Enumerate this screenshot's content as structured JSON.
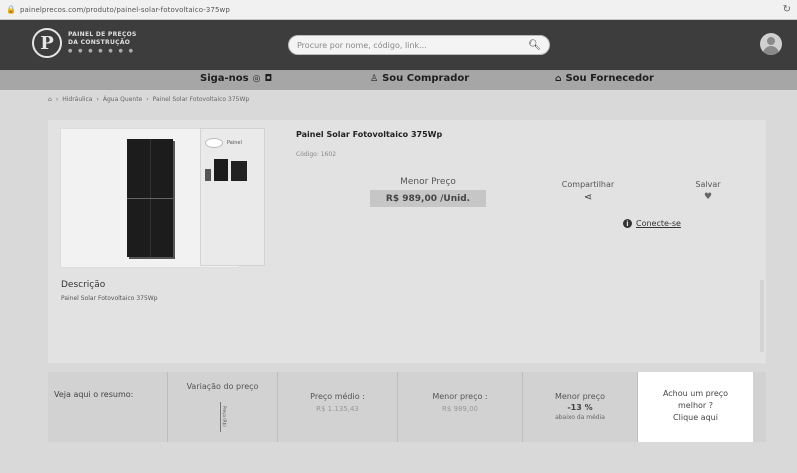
{
  "browser": {
    "url": "painelprecos.com/produto/painel-solar-fotovoltaico-375wp"
  },
  "header": {
    "logo_letter": "P",
    "logo_line1": "PAINEL DE PREÇOS",
    "logo_line2": "DA CONSTRUÇÃO",
    "logo_dots": "● ● ● ● ● ● ●",
    "search_placeholder": "Procure por nome, código, link..."
  },
  "nav": {
    "follow": "Siga-nos",
    "buyer": "Sou Comprador",
    "supplier": "Sou Fornecedor"
  },
  "breadcrumb": [
    "Hidráulica",
    "Água Quente",
    "Painel Solar Fotovoltaico 375Wp"
  ],
  "product": {
    "thumb_caption": "Painel",
    "title": "Painel Solar Fotovoltaico 375Wp",
    "code": "Código: 1602",
    "price_label": "Menor Preço",
    "price_value": "R$ 989,00 /Unid.",
    "share_label": "Compartilhar",
    "save_label": "Salvar",
    "connect_label": "Conecte-se",
    "desc_label": "Descrição",
    "desc_text": "Painel Solar Fotovoltaico 375Wp"
  },
  "summary": {
    "resumo": "Veja aqui o resumo:",
    "variacao": "Variação do preço",
    "variacao_axis": "Preço (R$)",
    "medio_label": "Preço médio :",
    "medio_value": "R$ 1.135,43",
    "menor_label": "Menor preço :",
    "menor_value": "R$ 989,00",
    "pct_label": "Menor preço",
    "pct_value": "-13 %",
    "pct_sub": "abaixo da média",
    "action_line1": "Achou um preço",
    "action_line2": "melhor ?",
    "action_line3": "Clique aqui"
  }
}
